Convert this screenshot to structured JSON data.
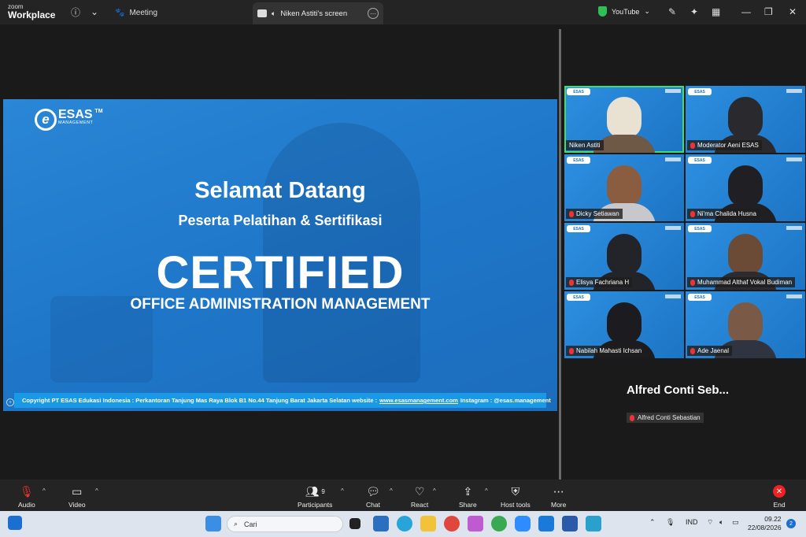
{
  "app": {
    "brand_top": "zoom",
    "brand_bottom": "Workplace"
  },
  "tabs": {
    "meeting": "Meeting",
    "screen": "Niken Astiti's screen"
  },
  "titlebar": {
    "youtube": "YouTube"
  },
  "slide": {
    "logo_word": "ESAS",
    "logo_sub": "MANAGEMENT",
    "logo_tm": "TM",
    "welcome": "Selamat Datang",
    "subtitle": "Peserta Pelatihan & Sertifikasi",
    "headline": "CERTIFIED",
    "program": "OFFICE ADMINISTRATION MANAGEMENT",
    "footer_pre": "Copyright PT ESAS Edukasi Indonesia : Perkantoran Tanjung Mas Raya Blok B1 No.44 Tanjung Barat Jakarta Selatan website :",
    "footer_link": "www.esasmanagement.com",
    "footer_post": "Instagram : @esas.management"
  },
  "participants": [
    {
      "name": "Niken Astiti",
      "muted": false,
      "active": true
    },
    {
      "name": "Moderator Aeni ESAS",
      "muted": true,
      "active": false
    },
    {
      "name": "Dicky Setiawan",
      "muted": true,
      "active": false
    },
    {
      "name": "Ni'ma Chalida Husna",
      "muted": true,
      "active": false
    },
    {
      "name": "Elisya Fachriana H",
      "muted": true,
      "active": false
    },
    {
      "name": "Muhammad Althaf Vokal Budiman",
      "muted": true,
      "active": false
    },
    {
      "name": "Nabilah Mahasti Ichsan",
      "muted": true,
      "active": false
    },
    {
      "name": "Ade Jaenal",
      "muted": true,
      "active": false
    }
  ],
  "tile_logo": "ESAS",
  "extra_participant": {
    "display": "Alfred Conti Seb...",
    "full": "Alfred Conti Sebastian"
  },
  "toolbar": {
    "audio": "Audio",
    "video": "Video",
    "participants": "Participants",
    "participant_count": "9",
    "chat": "Chat",
    "react": "React",
    "share": "Share",
    "host_tools": "Host tools",
    "more": "More",
    "end": "End"
  },
  "taskbar": {
    "search_placeholder": "Cari",
    "lang": "IND",
    "time": "09.22",
    "date": "22/08/2026",
    "notifications": "2"
  },
  "colors": {
    "accent": "#1f77c9",
    "active_speaker": "#3ddc74",
    "end": "#e22222"
  }
}
